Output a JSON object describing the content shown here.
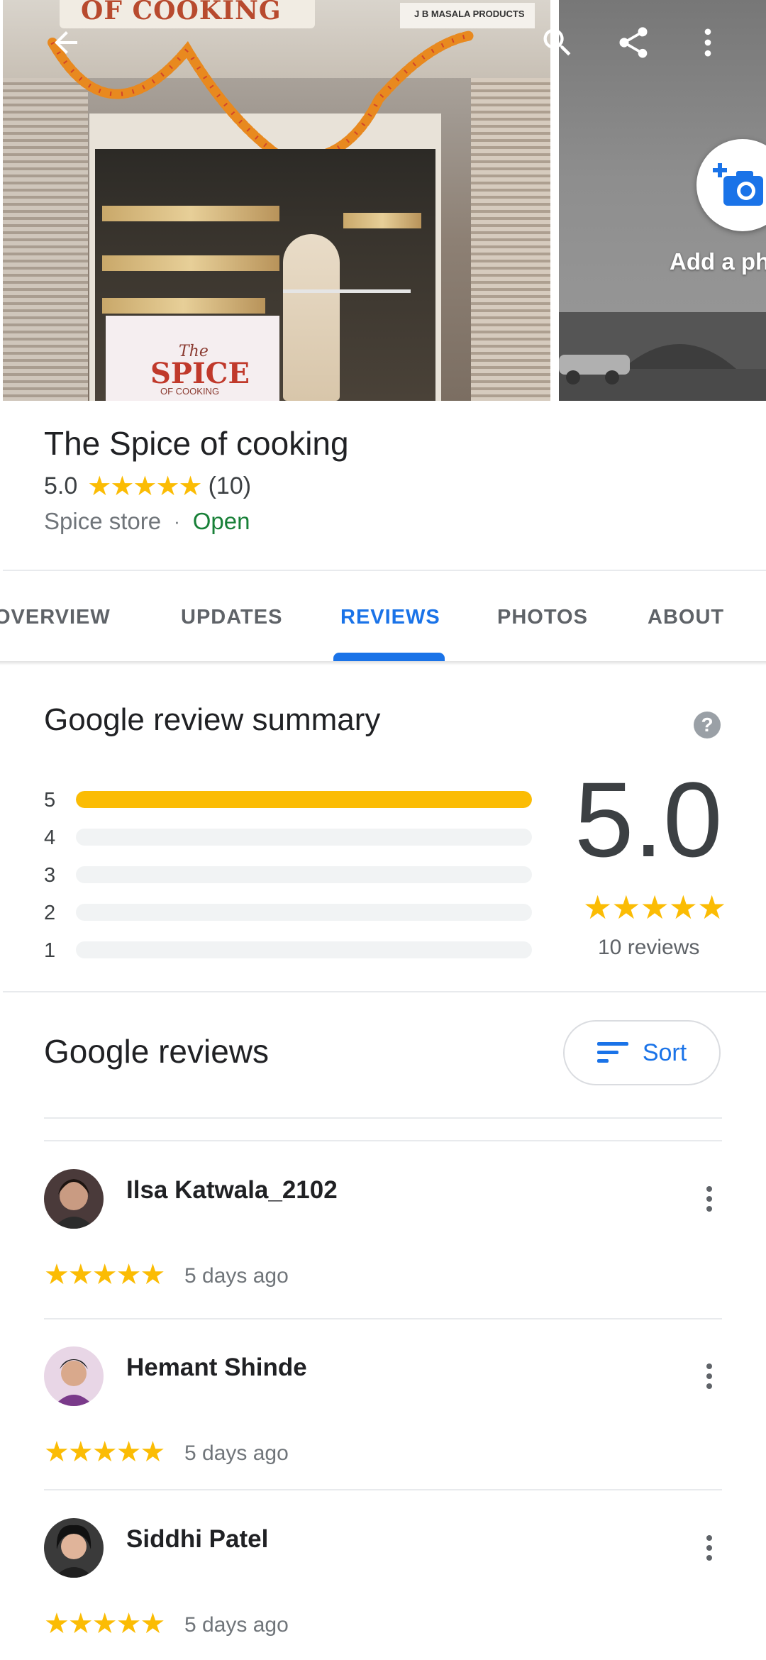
{
  "header": {
    "back_icon": "arrow-back-icon",
    "search_icon": "search-icon",
    "share_icon": "share-icon",
    "more_icon": "more-vert-icon"
  },
  "hero": {
    "sign_text": "OF COOKING",
    "sign_text2": "J B MASALA PRODUCTS",
    "store_sign_the": "The",
    "store_sign_main": "SPICE",
    "store_sign_sub": "OF COOKING",
    "add_photo_label": "Add a ph",
    "add_photo_icon": "add-photo-camera-icon"
  },
  "place": {
    "name": "The Spice of cooking",
    "rating": "5.0",
    "stars": "★★★★★",
    "count": "(10)",
    "category": "Spice store",
    "separator": "·",
    "status": "Open"
  },
  "tabs": [
    {
      "label": "OVERVIEW",
      "active": false
    },
    {
      "label": "UPDATES",
      "active": false
    },
    {
      "label": "REVIEWS",
      "active": true
    },
    {
      "label": "PHOTOS",
      "active": false
    },
    {
      "label": "ABOUT",
      "active": false
    }
  ],
  "summary": {
    "title": "Google review summary",
    "help_icon": "help-icon",
    "help_glyph": "?",
    "bars": [
      {
        "label": "5",
        "fraction": 1.0
      },
      {
        "label": "4",
        "fraction": 0.0
      },
      {
        "label": "3",
        "fraction": 0.0
      },
      {
        "label": "2",
        "fraction": 0.0
      },
      {
        "label": "1",
        "fraction": 0.0
      }
    ],
    "average": "5.0",
    "stars": "★★★★★",
    "count_label": "10 reviews"
  },
  "reviews_section": {
    "title": "Google reviews",
    "sort_label": "Sort",
    "sort_icon": "sort-icon"
  },
  "reviews": [
    {
      "name": "Ilsa Katwala_2102",
      "stars": "★★★★★",
      "date": "5 days ago"
    },
    {
      "name": "Hemant Shinde",
      "stars": "★★★★★",
      "date": "5 days ago"
    },
    {
      "name": "Siddhi Patel",
      "stars": "★★★★★",
      "date": "5 days ago"
    }
  ],
  "colors": {
    "accent": "#1a73e8",
    "star": "#fbbc04",
    "open": "#188038"
  }
}
